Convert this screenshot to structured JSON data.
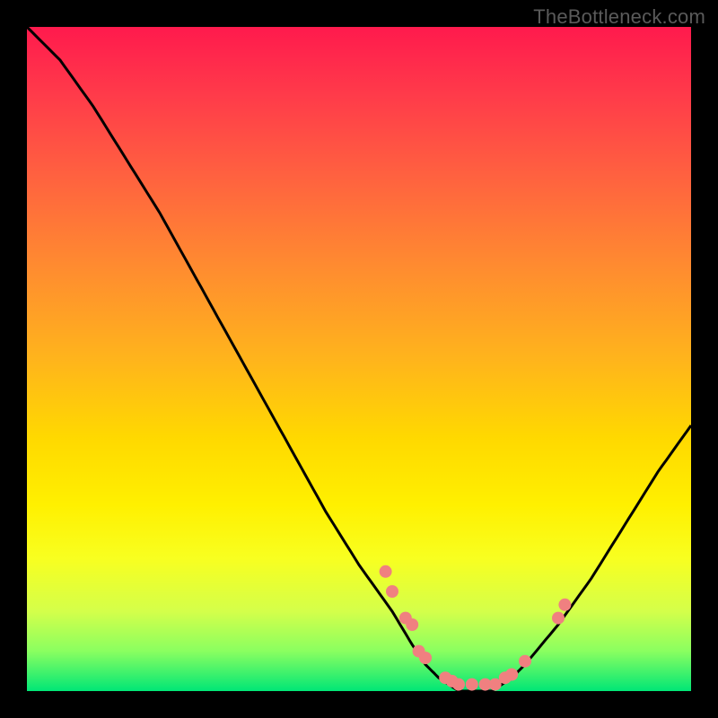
{
  "watermark": "TheBottleneck.com",
  "chart_data": {
    "type": "line",
    "title": "",
    "xlabel": "",
    "ylabel": "",
    "xlim": [
      0,
      100
    ],
    "ylim": [
      0,
      100
    ],
    "curve": {
      "name": "bottleneck-curve",
      "x": [
        0,
        5,
        10,
        15,
        20,
        25,
        30,
        35,
        40,
        45,
        50,
        55,
        58,
        60,
        62,
        65,
        68,
        70,
        73,
        75,
        80,
        85,
        90,
        95,
        100
      ],
      "y": [
        100,
        95,
        88,
        80,
        72,
        63,
        54,
        45,
        36,
        27,
        19,
        12,
        7,
        4,
        2,
        0,
        0,
        0,
        2,
        4,
        10,
        17,
        25,
        33,
        40
      ]
    },
    "scatter": {
      "name": "data-points",
      "color": "#f08080",
      "radius": 7,
      "points": [
        {
          "x": 54,
          "y": 18
        },
        {
          "x": 55,
          "y": 15
        },
        {
          "x": 57,
          "y": 11
        },
        {
          "x": 58,
          "y": 10
        },
        {
          "x": 59,
          "y": 6
        },
        {
          "x": 60,
          "y": 5
        },
        {
          "x": 63,
          "y": 2
        },
        {
          "x": 64,
          "y": 1.5
        },
        {
          "x": 65,
          "y": 1
        },
        {
          "x": 67,
          "y": 1
        },
        {
          "x": 69,
          "y": 1
        },
        {
          "x": 70.5,
          "y": 1
        },
        {
          "x": 72,
          "y": 2
        },
        {
          "x": 73,
          "y": 2.5
        },
        {
          "x": 75,
          "y": 4.5
        },
        {
          "x": 80,
          "y": 11
        },
        {
          "x": 81,
          "y": 13
        }
      ]
    }
  }
}
